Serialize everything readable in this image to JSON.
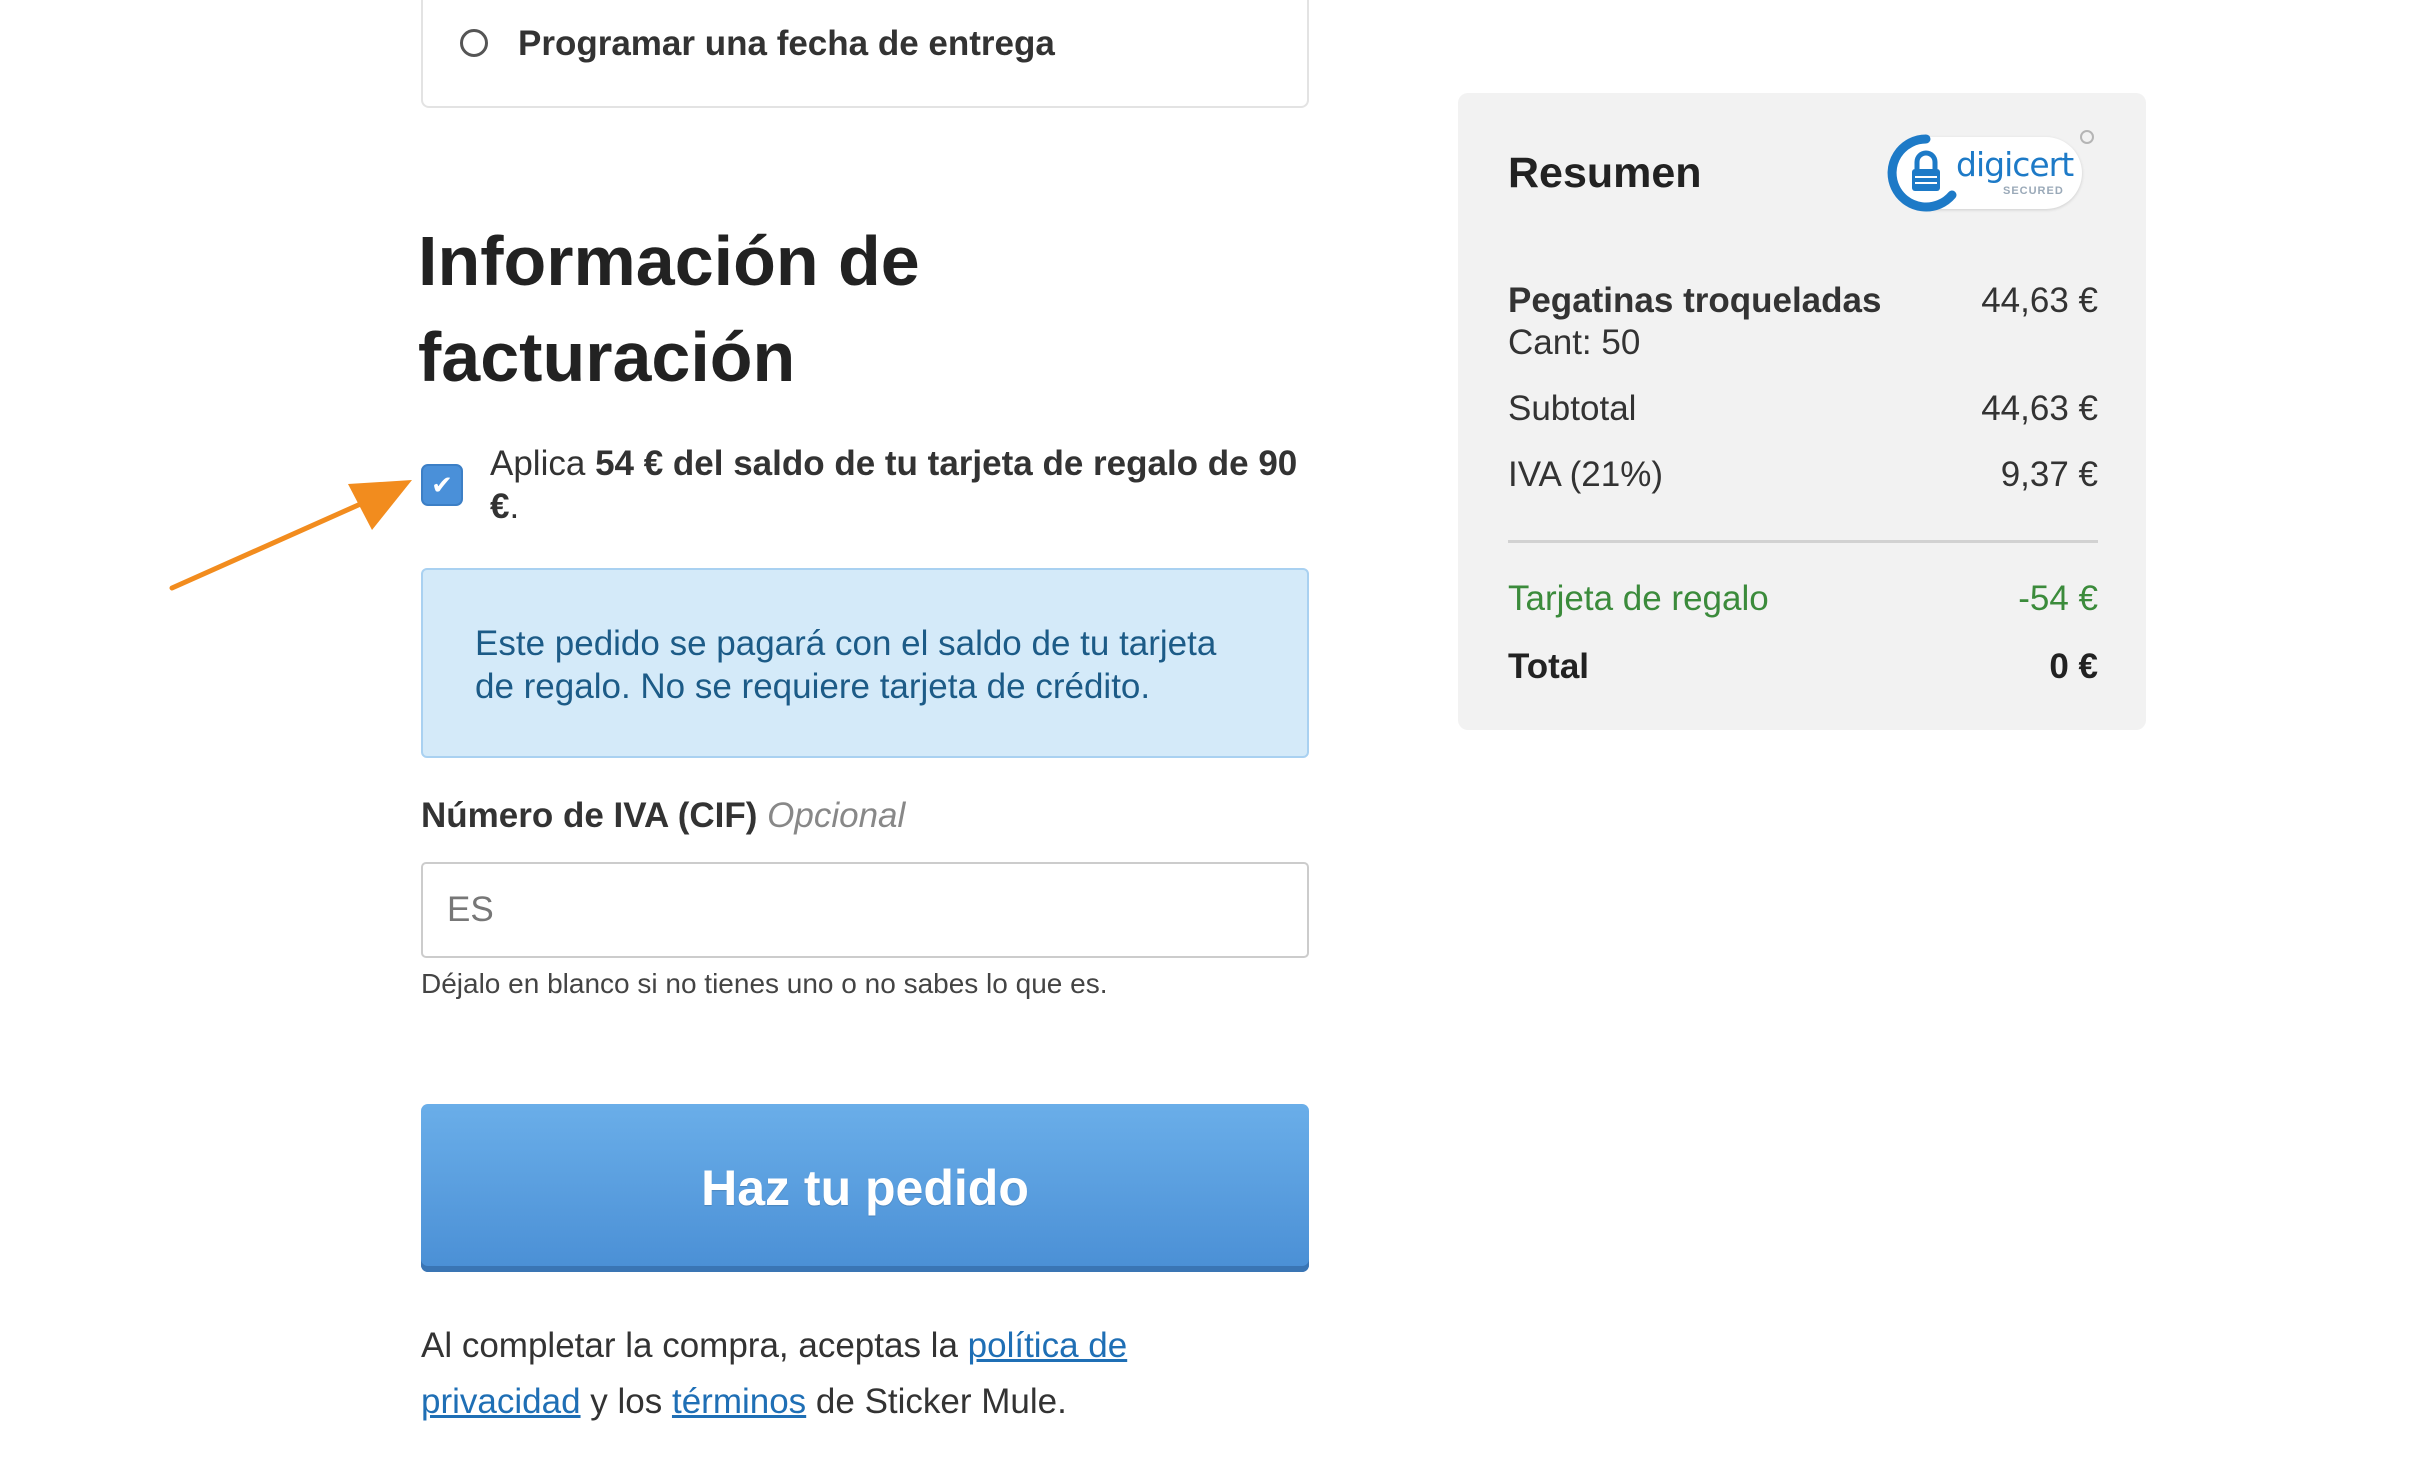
{
  "delivery": {
    "option_label": "Programar una fecha de entrega"
  },
  "billing": {
    "heading_line1": "Información de",
    "heading_line2": "facturación",
    "giftcard": {
      "prefix": "Aplica ",
      "bold_text": "54 € del saldo de tu tarjeta de regalo de 90 €",
      "suffix": ".",
      "checked": true
    },
    "info_message": "Este pedido se pagará con el saldo de tu tarjeta de regalo. No se requiere tarjeta de crédito.",
    "vat": {
      "label": "Número de IVA (CIF)",
      "optional": "Opcional",
      "placeholder": "ES",
      "value": "",
      "help": "Déjalo en blanco si no tienes uno o no sabes lo que es."
    },
    "submit_label": "Haz tu pedido",
    "terms": {
      "text1": "Al completar la compra, aceptas la ",
      "privacy_link": "política de privacidad",
      "text2": " y los ",
      "terms_link": "términos",
      "text3": " de Sticker Mule."
    }
  },
  "summary": {
    "title": "Resumen",
    "badge": {
      "brand": "digicert",
      "sub": "SECURED",
      "icon": "lock-icon"
    },
    "product": {
      "name": "Pegatinas troqueladas",
      "quantity": "Cant: 50",
      "price": "44,63 €"
    },
    "subtotal": {
      "label": "Subtotal",
      "value": "44,63 €"
    },
    "tax": {
      "label": "IVA (21%)",
      "value": "9,37 €"
    },
    "giftcard": {
      "label": "Tarjeta de regalo",
      "value": "-54 €"
    },
    "total": {
      "label": "Total",
      "value": "0 €"
    }
  },
  "annotation": {
    "arrow_color": "#f28c1e"
  },
  "colors": {
    "accent_blue": "#4a90d9",
    "link_blue": "#1f6fb5",
    "info_bg": "#d4eaf9",
    "info_text": "#1c5b87",
    "giftcard_green": "#3b8b3b",
    "summary_bg": "#f2f2f2"
  }
}
